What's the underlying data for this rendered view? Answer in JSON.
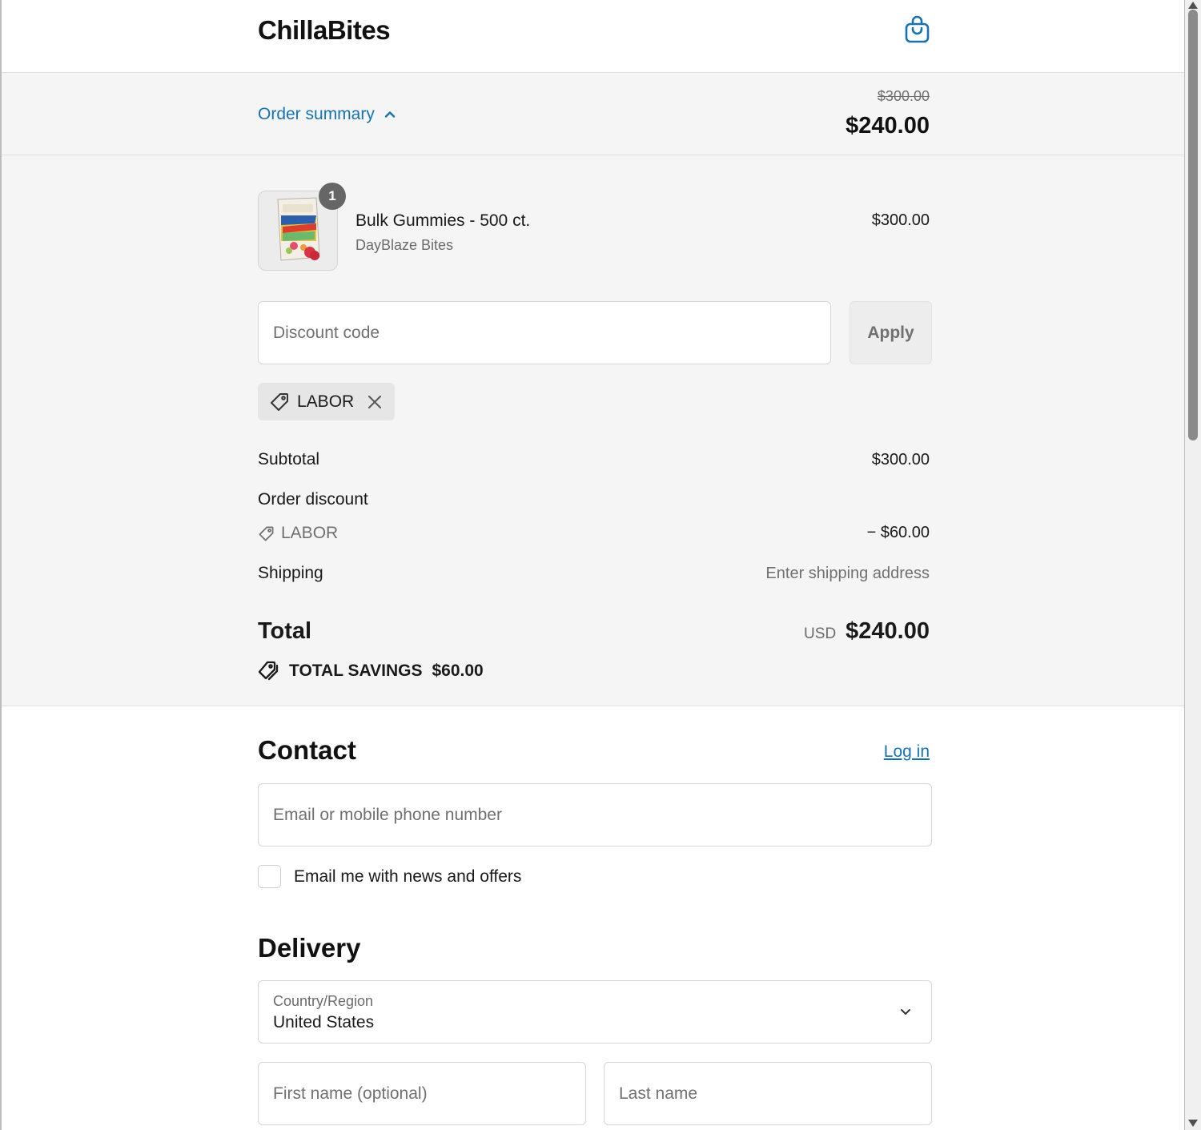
{
  "header": {
    "brand": "ChillaBites",
    "cart_icon": "shopping-bag-icon"
  },
  "summary_bar": {
    "toggle_label": "Order summary",
    "toggle_icon": "chevron-up-icon",
    "original_price": "$300.00",
    "total_price": "$240.00"
  },
  "line_item": {
    "quantity": "1",
    "title": "Bulk Gummies - 500 ct.",
    "vendor": "DayBlaze Bites",
    "price": "$300.00"
  },
  "discount": {
    "placeholder": "Discount code",
    "apply_label": "Apply",
    "applied_code": "LABOR"
  },
  "totals": {
    "subtotal_label": "Subtotal",
    "subtotal_value": "$300.00",
    "order_discount_label": "Order discount",
    "discount_code": "LABOR",
    "discount_value": "− $60.00",
    "shipping_label": "Shipping",
    "shipping_value": "Enter shipping address",
    "total_label": "Total",
    "currency": "USD",
    "total_value": "$240.00",
    "savings_label": "TOTAL SAVINGS",
    "savings_value": "$60.00"
  },
  "contact": {
    "title": "Contact",
    "login_label": "Log in",
    "email_placeholder": "Email or mobile phone number",
    "newsletter_label": "Email me with news and offers",
    "newsletter_checked": false
  },
  "delivery": {
    "title": "Delivery",
    "country_label": "Country/Region",
    "country_value": "United States",
    "first_name_placeholder": "First name (optional)",
    "last_name_placeholder": "Last name"
  },
  "colors": {
    "accent": "#1773b0",
    "summary_bg": "#f5f5f5",
    "badge": "#666666"
  }
}
